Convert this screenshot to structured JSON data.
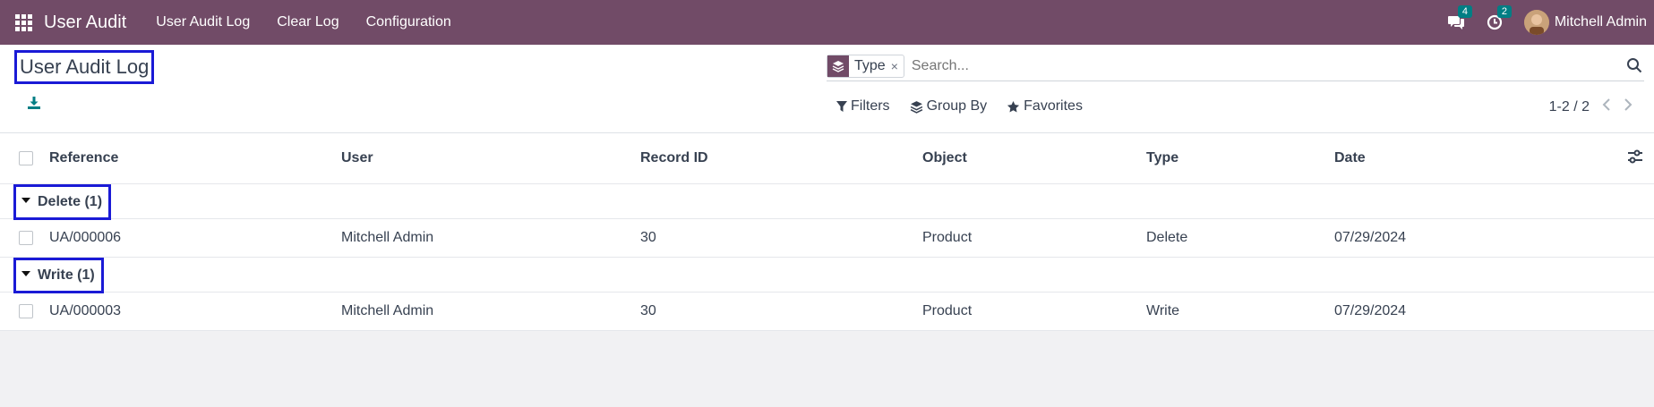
{
  "navbar": {
    "app_name": "User Audit",
    "menu": [
      "User Audit Log",
      "Clear Log",
      "Configuration"
    ],
    "messages_badge": "4",
    "activities_badge": "2",
    "user_name": "Mitchell Admin",
    "bg_color": "#714b67"
  },
  "control_panel": {
    "title": "User Audit Log",
    "facet_label": "Type",
    "facet_remove": "×",
    "search_placeholder": "Search...",
    "filters_label": "Filters",
    "group_by_label": "Group By",
    "favorites_label": "Favorites",
    "pager_value": "1-2 / 2"
  },
  "list": {
    "columns": [
      "Reference",
      "User",
      "Record ID",
      "Object",
      "Type",
      "Date"
    ],
    "groups": [
      {
        "label": "Delete (1)",
        "rows": [
          {
            "reference": "UA/000006",
            "user": "Mitchell Admin",
            "record_id": "30",
            "object": "Product",
            "type": "Delete",
            "date": "07/29/2024"
          }
        ]
      },
      {
        "label": "Write (1)",
        "rows": [
          {
            "reference": "UA/000003",
            "user": "Mitchell Admin",
            "record_id": "30",
            "object": "Product",
            "type": "Write",
            "date": "07/29/2024"
          }
        ]
      }
    ]
  }
}
